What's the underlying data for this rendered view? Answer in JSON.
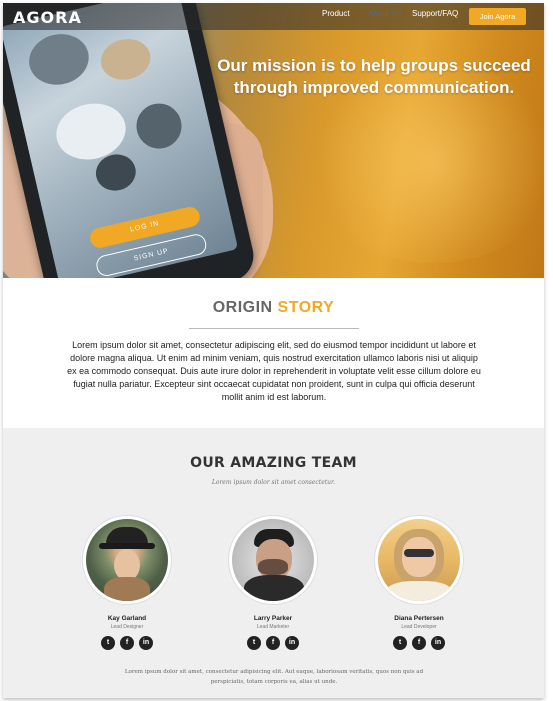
{
  "nav": {
    "logo_text": "AGORA",
    "items": [
      "Product",
      "About Us",
      "Support/FAQ"
    ],
    "active_index": 1,
    "join_label": "Join Agora"
  },
  "hero": {
    "mission": "Our mission is to help groups succeed through improved communication.",
    "phone_login": "LOG IN",
    "phone_signup": "SIGN UP"
  },
  "origin": {
    "title_part1": "ORIGIN",
    "title_part2": "STORY",
    "body": "Lorem ipsum dolor sit amet, consectetur adipiscing elit, sed do eiusmod tempor incididunt ut labore et dolore magna aliqua. Ut enim ad minim veniam, quis nostrud exercitation ullamco laboris nisi ut aliquip ex ea commodo consequat. Duis aute irure dolor in reprehenderit in voluptate velit esse cillum dolore eu fugiat nulla pariatur. Excepteur sint occaecat cupidatat non proident, sunt in culpa qui officia deserunt mollit anim id est laborum."
  },
  "team": {
    "title": "OUR AMAZING TEAM",
    "subtitle": "Lorem ipsum dolor sit amet consectetur.",
    "members": [
      {
        "name": "Kay Garland",
        "role": "Lead Designer"
      },
      {
        "name": "Larry Parker",
        "role": "Lead Marketer"
      },
      {
        "name": "Diana Pertersen",
        "role": "Lead Developer"
      }
    ],
    "social_icons": [
      "twitter-icon",
      "facebook-icon",
      "linkedin-icon"
    ],
    "footer": "Lorem ipsum dolor sit amet, consectetur adipisicing elit. Aut eaque, laboriosam veritatis, quos non quis ad perspiciatis, totam corporis ea, alias ut unde."
  },
  "colors": {
    "accent": "#f0a825",
    "heading_gray": "#666666",
    "team_bg": "#efefef"
  }
}
